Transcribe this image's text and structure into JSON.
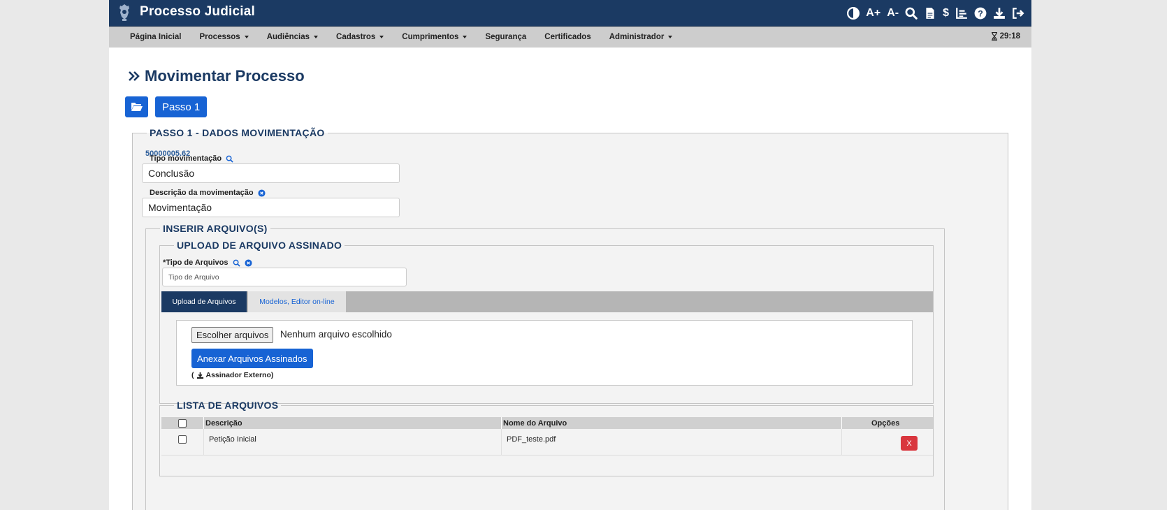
{
  "header": {
    "title": "Processo Judicial",
    "icons": [
      {
        "name": "contrast-icon",
        "glyph": "◐",
        "label": ""
      },
      {
        "name": "increase-font-icon",
        "glyph": "",
        "label": "A+"
      },
      {
        "name": "decrease-font-icon",
        "glyph": "",
        "label": "A-"
      },
      {
        "name": "search-icon",
        "glyph": "",
        "label": ""
      },
      {
        "name": "document-icon",
        "glyph": "",
        "label": ""
      },
      {
        "name": "dollar-icon",
        "glyph": "$",
        "label": ""
      },
      {
        "name": "chart-icon",
        "glyph": "",
        "label": ""
      },
      {
        "name": "help-icon",
        "glyph": "?",
        "label": ""
      },
      {
        "name": "download-icon",
        "glyph": "",
        "label": ""
      },
      {
        "name": "logout-icon",
        "glyph": "",
        "label": ""
      }
    ]
  },
  "nav": {
    "items": [
      {
        "label": "Página Inicial",
        "dropdown": false
      },
      {
        "label": "Processos",
        "dropdown": true
      },
      {
        "label": "Audiências",
        "dropdown": true
      },
      {
        "label": "Cadastros",
        "dropdown": true
      },
      {
        "label": "Cumprimentos",
        "dropdown": true
      },
      {
        "label": "Segurança",
        "dropdown": false
      },
      {
        "label": "Certificados",
        "dropdown": false
      },
      {
        "label": "Administrador",
        "dropdown": true
      }
    ],
    "timer": "29:18"
  },
  "page": {
    "title": "Movimentar Processo",
    "step_button": "Passo 1"
  },
  "step1": {
    "legend": "PASSO 1 - DADOS MOVIMENTAÇÃO",
    "process_number": "50000005.62",
    "tipo_label": "Tipo movimentação",
    "tipo_value": "Conclusão",
    "descricao_label": "Descrição da movimentação",
    "descricao_value": "Movimentação"
  },
  "inserir": {
    "legend": "INSERIR ARQUIVO(S)"
  },
  "upload": {
    "legend": "UPLOAD DE ARQUIVO ASSINADO",
    "tipo_label": "*Tipo de Arquivos",
    "tipo_placeholder": "Tipo de Arquivo",
    "tabs": [
      "Upload de Arquivos",
      "Modelos, Editor on-line"
    ],
    "file_button": "Escolher arquivos",
    "file_status": "Nenhum arquivo escolhido",
    "attach_button": "Anexar Arquivos Assinados",
    "external_signer": "(",
    "external_signer_text": "Assinador Externo)"
  },
  "lista": {
    "legend": "LISTA DE ARQUIVOS",
    "columns": [
      "Descrição",
      "Nome do Arquivo",
      "Opções"
    ],
    "rows": [
      {
        "descricao": "Petição Inicial",
        "arquivo": "PDF_teste.pdf",
        "delete_label": "X"
      }
    ]
  },
  "colors": {
    "header_bg": "#1b3a63",
    "primary": "#1763d4",
    "danger": "#d9363e",
    "navbar_bg": "#cdcdcd"
  }
}
